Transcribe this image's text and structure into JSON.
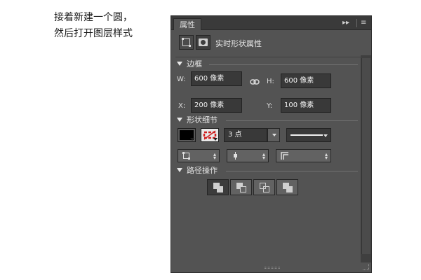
{
  "caption": {
    "line1": "接着新建一个圆，",
    "line2": "然后打开图层样式"
  },
  "panel": {
    "tab_label": "属性",
    "collapse_icon": "double-chevron-right",
    "menu_icon": "panel-menu",
    "header_title": "实时形状属性",
    "sections": {
      "bounds": "边框",
      "shape_details": "形状细节",
      "path_ops": "路径操作"
    },
    "bounds": {
      "w_label": "W:",
      "w_value": "600 像素",
      "h_label": "H:",
      "h_value": "600 像素",
      "x_label": "X:",
      "x_value": "200 像素",
      "y_label": "Y:",
      "y_value": "100 像素"
    },
    "shape": {
      "fill_color": "#000000",
      "stroke_color": "#d02020",
      "stroke_width": "3 点"
    },
    "path_operations": [
      "combine-shapes",
      "subtract-front-shape",
      "intersect-shape-areas",
      "exclude-overlapping-shapes"
    ]
  }
}
